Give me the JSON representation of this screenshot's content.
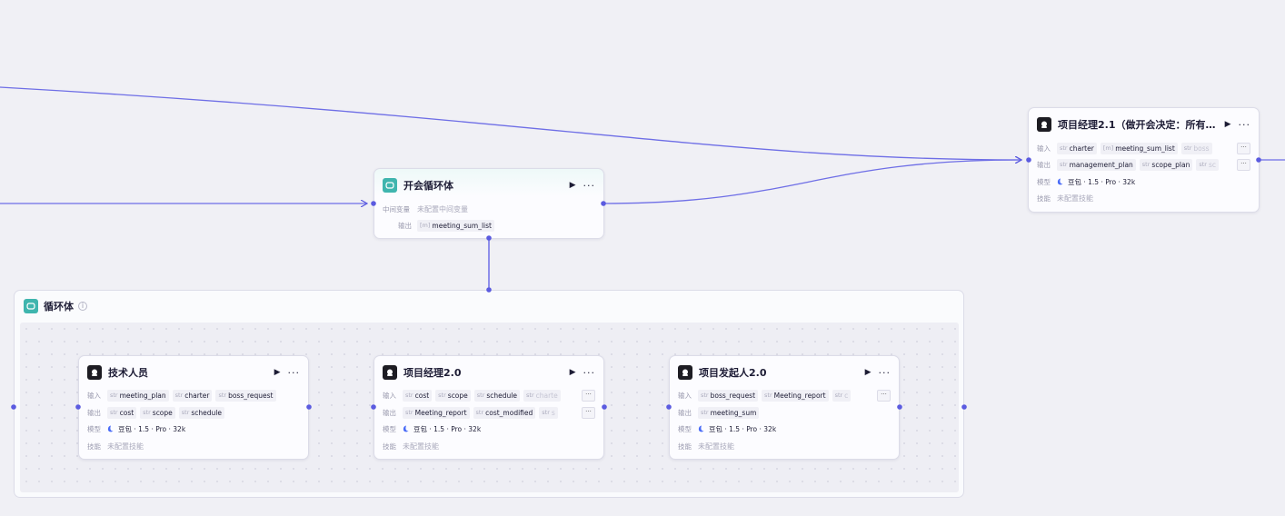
{
  "common": {
    "input_label": "输入",
    "output_label": "输出",
    "model_label": "模型",
    "skill_label": "技能",
    "type_str": "str",
    "type_list": "[m]",
    "model_name": "豆包 · 1.5 · Pro · 32k",
    "skill_value": "未配置技能",
    "more": "···"
  },
  "pm21": {
    "title": "项目经理2.1（做开会决定：所有…",
    "inputs": [
      "charter",
      "meeting_sum_list",
      "boss"
    ],
    "outputs": [
      "management_plan",
      "scope_plan",
      "sc"
    ]
  },
  "meeting_loop": {
    "title": "开会循环体",
    "var_label": "中间变量",
    "var_value": "未配置中间变量",
    "output_label": "输出",
    "output": "meeting_sum_list"
  },
  "loop_body": {
    "title": "循环体",
    "info_icon": "info-icon"
  },
  "tech": {
    "title": "技术人员",
    "inputs": [
      "meeting_plan",
      "charter",
      "boss_request"
    ],
    "outputs": [
      "cost",
      "scope",
      "schedule"
    ]
  },
  "pm20": {
    "title": "项目经理2.0",
    "inputs": [
      "cost",
      "scope",
      "schedule",
      "charte"
    ],
    "outputs": [
      "Meeting_report",
      "cost_modified",
      "s"
    ]
  },
  "sponsor": {
    "title": "项目发起人2.0",
    "inputs": [
      "boss_request",
      "Meeting_report",
      "c"
    ],
    "outputs": [
      "meeting_sum"
    ]
  },
  "colors": {
    "edge": "#5b5be0",
    "background": "#f0f0f5",
    "loop_icon": "#3fb5ae",
    "node_icon": "#1d1c23"
  }
}
